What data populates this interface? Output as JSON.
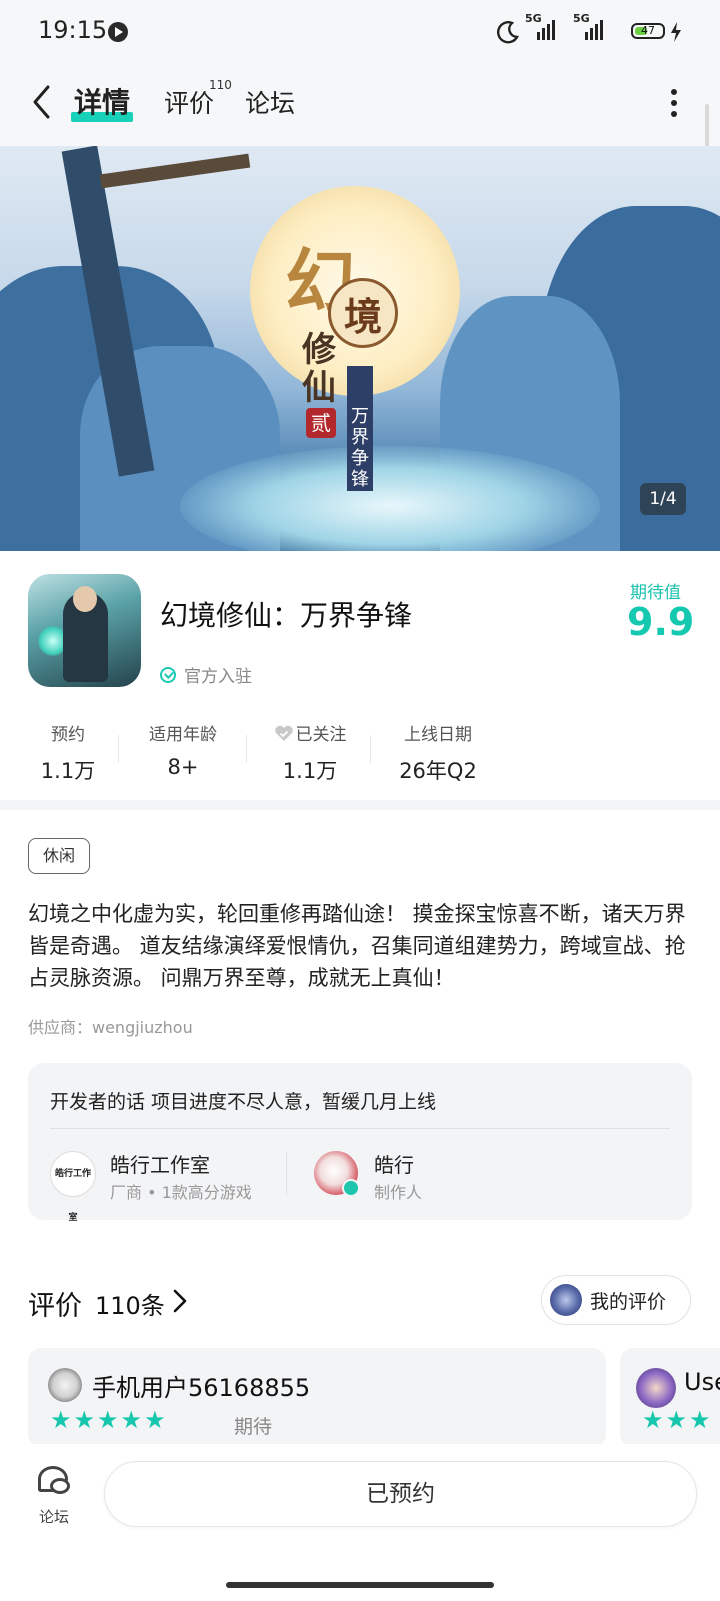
{
  "status": {
    "time": "19:15",
    "signal1": "5G",
    "signal2": "5G",
    "battery": "47",
    "battery_fraction": 0.47
  },
  "nav": {
    "tabs": [
      {
        "label": "详情",
        "active": true
      },
      {
        "label": "评价",
        "badge": "110"
      },
      {
        "label": "论坛"
      }
    ]
  },
  "banner": {
    "title_char1": "幻",
    "title_char2": "境",
    "title_char34": "修仙",
    "seal_char": "贰",
    "subtitle": "万界争锋",
    "pager": "1/4"
  },
  "app": {
    "name": "幻境修仙：万界争锋",
    "official": "官方入驻",
    "expect_label": "期待值",
    "expect_value": "9.9",
    "stats": [
      {
        "label": "预约",
        "value": "1.1万"
      },
      {
        "label": "适用年龄",
        "value": "8+"
      },
      {
        "label": "已关注",
        "value": "1.1万"
      },
      {
        "label": "上线日期",
        "value": "26年Q2"
      }
    ]
  },
  "detail": {
    "tag": "休闲",
    "description": "幻境之中化虚为实，轮回重修再踏仙途！ 摸金探宝惊喜不断，诸天万界皆是奇遇。 道友结缘演绎爱恨情仇，召集同道组建势力，跨域宣战、抢占灵脉资源。 问鼎万界至尊，成就无上真仙！",
    "vendor": "供应商：wengjiuzhou"
  },
  "developer": {
    "words": "开发者的话  项目进度不尽人意，暂缓几月上线",
    "studio_avatar_text": "皓行工作室",
    "studio_name": "皓行工作室",
    "studio_sub": "厂商 • 1款高分游戏",
    "person_name": "皓行",
    "person_sub": "制作人"
  },
  "reviews": {
    "title": "评价",
    "count": "110条",
    "my_review": "我的评价",
    "cards": [
      {
        "user": "手机用户56168855",
        "stars": "★★★★★",
        "tag": "期待"
      },
      {
        "user": "Use",
        "stars": "★★★"
      }
    ]
  },
  "bottom": {
    "forum": "论坛",
    "button": "已预约"
  },
  "colors": {
    "accent": "#19d1b9",
    "background": "#ffffff"
  }
}
